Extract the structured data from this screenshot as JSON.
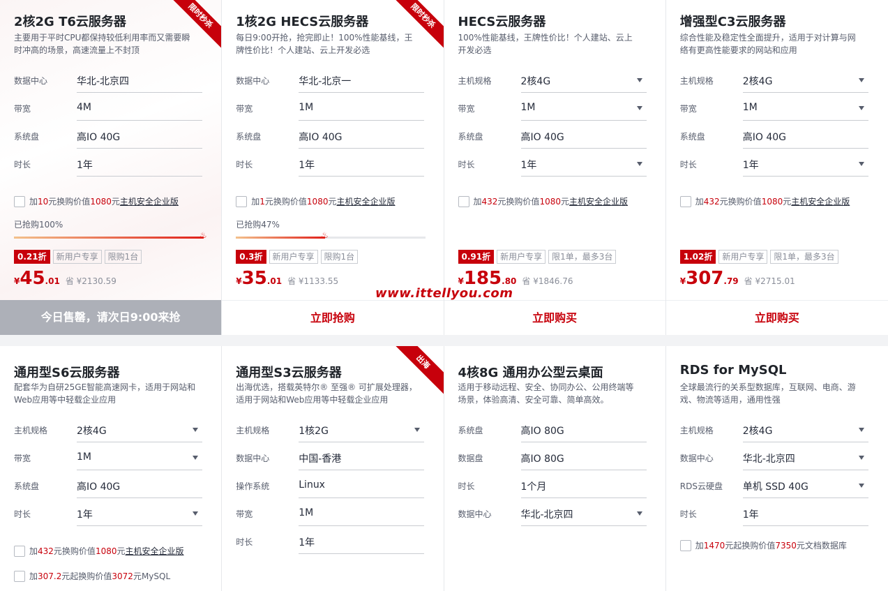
{
  "watermark": "www.ittellyou.com",
  "cards_row1": [
    {
      "title": "2核2G T6云服务器",
      "desc": "主要用于平时CPU都保持较低利用率而又需要瞬时冲高的场景，高速流量上不封顶",
      "ribbon": "限时秒杀",
      "specs": [
        {
          "label": "数据中心",
          "value": "华北-北京四"
        },
        {
          "label": "带宽",
          "value": "4M"
        },
        {
          "label": "系统盘",
          "value": "高IO 40G"
        },
        {
          "label": "时长",
          "value": "1年"
        }
      ],
      "addon": {
        "pre": "加",
        "amt": "10",
        "mid": "元换购价值",
        "val": "1080",
        "unit": "元",
        "link": "主机安全企业版"
      },
      "progress_label": "已抢购100%",
      "progress": 100,
      "tags": [
        "0.21折",
        "新用户专享",
        "限购1台"
      ],
      "price": {
        "cur": "¥",
        "int": "45",
        "dec": ".01",
        "save": "省 ¥2130.59"
      },
      "cta": "今日售罄，请次日9:00来抢"
    },
    {
      "title": "1核2G HECS云服务器",
      "desc": "每日9:00开抢，抢完即止！100%性能基线，王牌性价比！个人建站、云上开发必选",
      "ribbon": "限时秒杀",
      "specs": [
        {
          "label": "数据中心",
          "value": "华北-北京一"
        },
        {
          "label": "带宽",
          "value": "1M"
        },
        {
          "label": "系统盘",
          "value": "高IO 40G"
        },
        {
          "label": "时长",
          "value": "1年"
        }
      ],
      "addon": {
        "pre": "加",
        "amt": "1",
        "mid": "元换购价值",
        "val": "1080",
        "unit": "元",
        "link": "主机安全企业版"
      },
      "progress_label": "已抢购47%",
      "progress": 47,
      "tags": [
        "0.3折",
        "新用户专享",
        "限购1台"
      ],
      "price": {
        "cur": "¥",
        "int": "35",
        "dec": ".01",
        "save": "省 ¥1133.55"
      },
      "cta": "立即抢购"
    },
    {
      "title": "HECS云服务器",
      "desc": "100%性能基线，王牌性价比！个人建站、云上开发必选",
      "ribbon": "",
      "specs": [
        {
          "label": "主机规格",
          "value": "2核4G"
        },
        {
          "label": "带宽",
          "value": "1M"
        },
        {
          "label": "系统盘",
          "value": "高IO 40G"
        },
        {
          "label": "时长",
          "value": "1年"
        }
      ],
      "addon": {
        "pre": "加",
        "amt": "432",
        "mid": "元换购价值",
        "val": "1080",
        "unit": "元",
        "link": "主机安全企业版"
      },
      "tags": [
        "0.91折",
        "新用户专享",
        "限1单，最多3台"
      ],
      "price": {
        "cur": "¥",
        "int": "185",
        "dec": ".80",
        "save": "省 ¥1846.76"
      },
      "cta": "立即购买"
    },
    {
      "title": "增强型C3云服务器",
      "desc": "综合性能及稳定性全面提升，适用于对计算与网络有更高性能要求的网站和应用",
      "ribbon": "",
      "specs": [
        {
          "label": "主机规格",
          "value": "2核4G"
        },
        {
          "label": "带宽",
          "value": "1M"
        },
        {
          "label": "系统盘",
          "value": "高IO 40G"
        },
        {
          "label": "时长",
          "value": "1年"
        }
      ],
      "addon": {
        "pre": "加",
        "amt": "432",
        "mid": "元换购价值",
        "val": "1080",
        "unit": "元",
        "link": "主机安全企业版"
      },
      "tags": [
        "1.02折",
        "新用户专享",
        "限1单，最多3台"
      ],
      "price": {
        "cur": "¥",
        "int": "307",
        "dec": ".79",
        "save": "省 ¥2715.01"
      },
      "cta": "立即购买"
    }
  ],
  "cards_row2": [
    {
      "title": "通用型S6云服务器",
      "desc": "配套华为自研25GE智能高速网卡，适用于网站和Web应用等中轻载企业应用",
      "ribbon": "",
      "specs": [
        {
          "label": "主机规格",
          "value": "2核4G"
        },
        {
          "label": "带宽",
          "value": "1M"
        },
        {
          "label": "系统盘",
          "value": "高IO 40G"
        },
        {
          "label": "时长",
          "value": "1年"
        }
      ],
      "addons": [
        {
          "pre": "加",
          "amt": "432",
          "mid": "元换购价值",
          "val": "1080",
          "unit": "元",
          "link": "主机安全企业版"
        },
        {
          "pre": "加",
          "amt": "307.2",
          "mid": "元起换购价值",
          "val": "3072",
          "unit": "元MySQL",
          "link": ""
        }
      ]
    },
    {
      "title": "通用型S3云服务器",
      "desc": "出海优选，搭载英特尔® 至强® 可扩展处理器，适用于网站和Web应用等中轻载企业应用",
      "ribbon": "出海",
      "specs": [
        {
          "label": "主机规格",
          "value": "1核2G"
        },
        {
          "label": "数据中心",
          "value": "中国-香港"
        },
        {
          "label": "操作系统",
          "value": "Linux"
        },
        {
          "label": "带宽",
          "value": "1M"
        },
        {
          "label": "时长",
          "value": "1年"
        }
      ],
      "addons": []
    },
    {
      "title": "4核8G 通用办公型云桌面",
      "desc": "适用于移动远程、安全、协同办公、公用终端等场景，体验高清、安全可靠、简单高效。",
      "ribbon": "",
      "specs": [
        {
          "label": "系统盘",
          "value": "高IO 80G"
        },
        {
          "label": "数据盘",
          "value": "高IO 80G"
        },
        {
          "label": "时长",
          "value": "1个月"
        },
        {
          "label": "数据中心",
          "value": "华北-北京四"
        }
      ],
      "addons": []
    },
    {
      "title": "RDS for MySQL",
      "desc": "全球最流行的关系型数据库，互联网、电商、游戏、物流等适用，通用性强",
      "ribbon": "",
      "specs": [
        {
          "label": "主机规格",
          "value": "2核4G"
        },
        {
          "label": "数据中心",
          "value": "华北-北京四"
        },
        {
          "label": "RDS云硬盘",
          "value": "单机 SSD 40G"
        },
        {
          "label": "时长",
          "value": "1年"
        }
      ],
      "addons": [
        {
          "pre": "加",
          "amt": "1470",
          "mid": "元起换购价值",
          "val": "7350",
          "unit": "元文档数据库",
          "link": ""
        }
      ]
    }
  ]
}
